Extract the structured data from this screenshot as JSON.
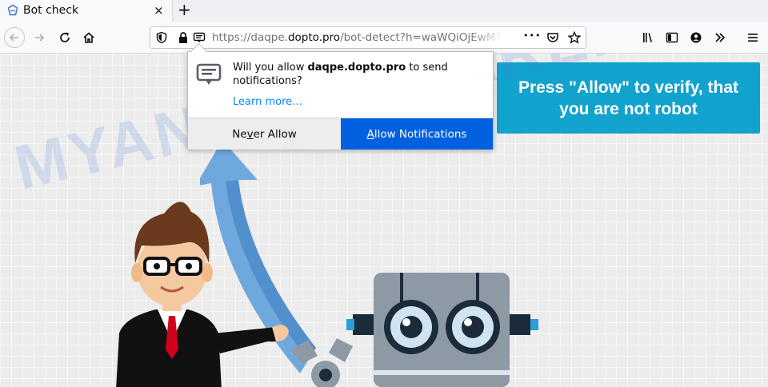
{
  "tab": {
    "title": "Bot check",
    "close_glyph": "×",
    "new_tab_glyph": "+"
  },
  "address_bar": {
    "url_prefix": "https://daqpe.",
    "url_domain": "dopto.pro",
    "url_rest": "/bot-detect?h=waWQiOjEwMTQ",
    "more_glyph": "•••"
  },
  "notification": {
    "message_before": "Will you allow ",
    "message_site": "daqpe.dopto.pro",
    "message_after": " to send notifications?",
    "learn_more": "Learn more…",
    "never_allow_pre": "Ne",
    "never_allow_key": "v",
    "never_allow_post": "er Allow",
    "allow_key": "A",
    "allow_post": "llow Notifications"
  },
  "page": {
    "banner_text": "Press \"Allow\" to verify, that you are not robot",
    "watermark": "MYANTISPYWARE.COM"
  },
  "colors": {
    "banner": "#11a2cd",
    "allow_button": "#0060df",
    "link": "#0a84ff",
    "arrow": "#6fa8dc"
  },
  "icons": {
    "tab": "globe-icon",
    "back": "back-arrow-icon",
    "forward": "forward-arrow-icon",
    "reload": "reload-icon",
    "home": "home-icon",
    "shield": "tracking-shield-icon",
    "lock": "lock-icon",
    "notification": "notification-permission-icon",
    "pocket": "pocket-icon",
    "bookmark": "bookmark-star-icon",
    "library": "library-icon",
    "sidebar": "sidebar-icon",
    "account": "account-icon",
    "overflow": "overflow-chevrons-icon",
    "menu": "hamburger-menu-icon"
  }
}
